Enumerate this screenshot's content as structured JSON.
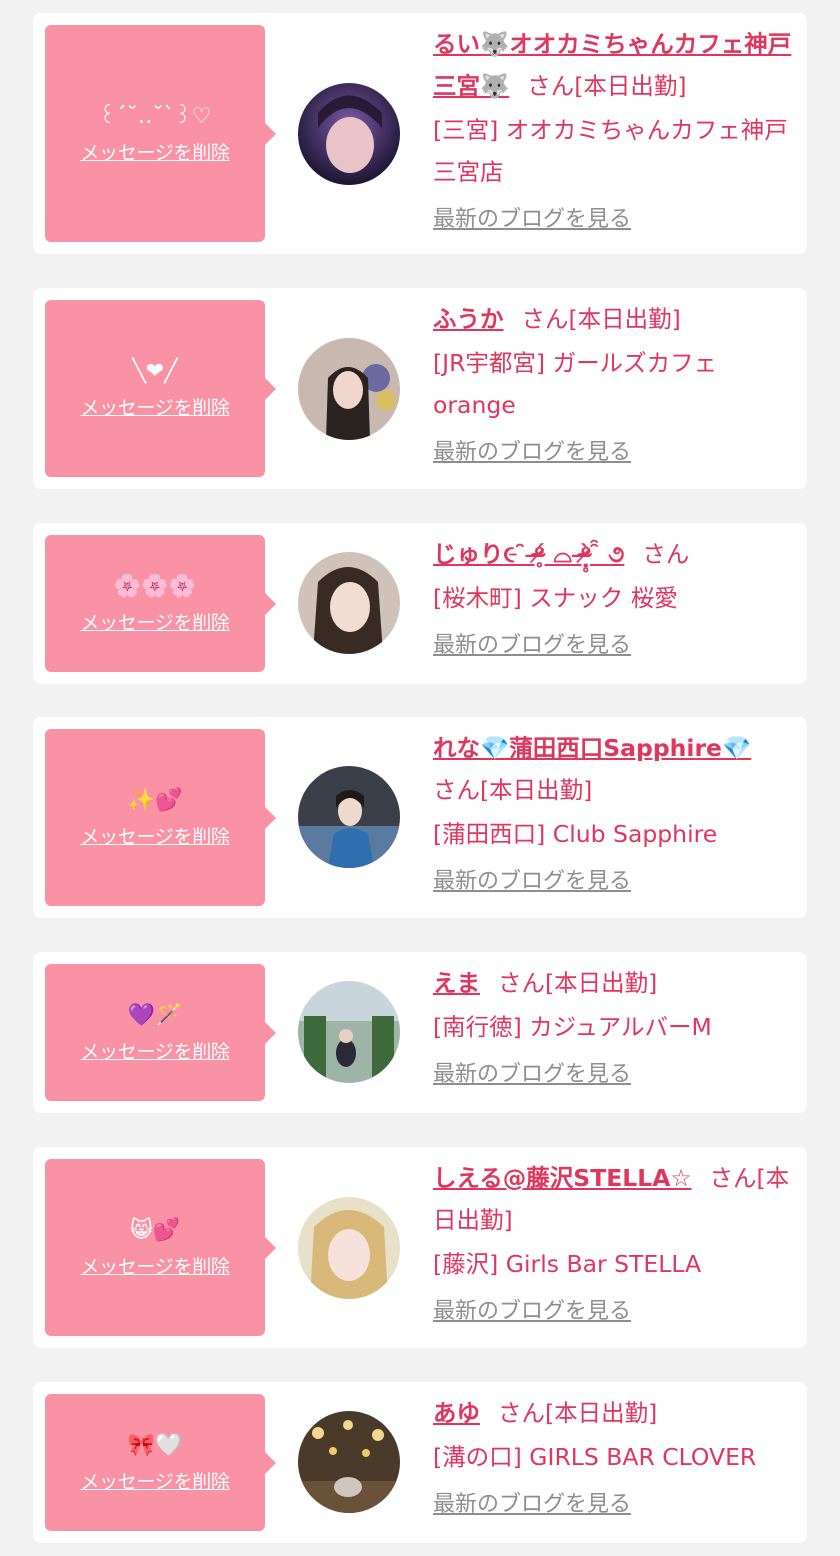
{
  "labels": {
    "delete": "メッセージを削除",
    "blog": "最新のブログを見る"
  },
  "colors": {
    "background": "#f2f2f2",
    "card": "#ffffff",
    "bubble": "#fa92a5",
    "accent": "#e0365e",
    "link_gray": "#8e8e8e"
  },
  "items": [
    {
      "emoji": "꒰ˊ˘‥˘ˋ꒱♡",
      "name": "るい🐺オオカミちゃんカフェ神戸三宮🐺",
      "suffix": "さん[本日出勤]",
      "shop": "[三宮] オオカミちゃんカフェ神戸三宮店",
      "avatar": "avatar-photo"
    },
    {
      "emoji": "╲❤╱",
      "name": "ふうか",
      "suffix": "さん[本日出勤]",
      "shop": "[JR宇都宮] ガールズカフェorange",
      "avatar": "avatar-photo"
    },
    {
      "emoji": "🌸🌸🌸",
      "name": "じゅり૯ ̑̑ ᵒ̴̶̷̥́ ⌓ ᵒ̴̶̷̣̥̀ ̑̑ ૭",
      "suffix": "さん",
      "shop": "[桜木町] スナック 桜愛",
      "avatar": "avatar-photo"
    },
    {
      "emoji": "✨💕",
      "name": "れな💎蒲田西口Sapphire💎",
      "suffix": "さん[本日出勤]",
      "shop": "[蒲田西口] Club Sapphire",
      "avatar": "avatar-photo"
    },
    {
      "emoji": "💜🪄",
      "name": "えま",
      "suffix": "さん[本日出勤]",
      "shop": "[南行徳] カジュアルバーM",
      "avatar": "avatar-photo"
    },
    {
      "emoji": "😸💕",
      "name": "しえる@藤沢STELLA☆",
      "suffix": "さん[本日出勤]",
      "shop": "[藤沢] Girls Bar STELLA",
      "avatar": "avatar-photo"
    },
    {
      "emoji": "🎀🤍",
      "name": "あゆ",
      "suffix": "さん[本日出勤]",
      "shop": "[溝の口] GIRLS BAR CLOVER",
      "avatar": "avatar-photo"
    }
  ]
}
